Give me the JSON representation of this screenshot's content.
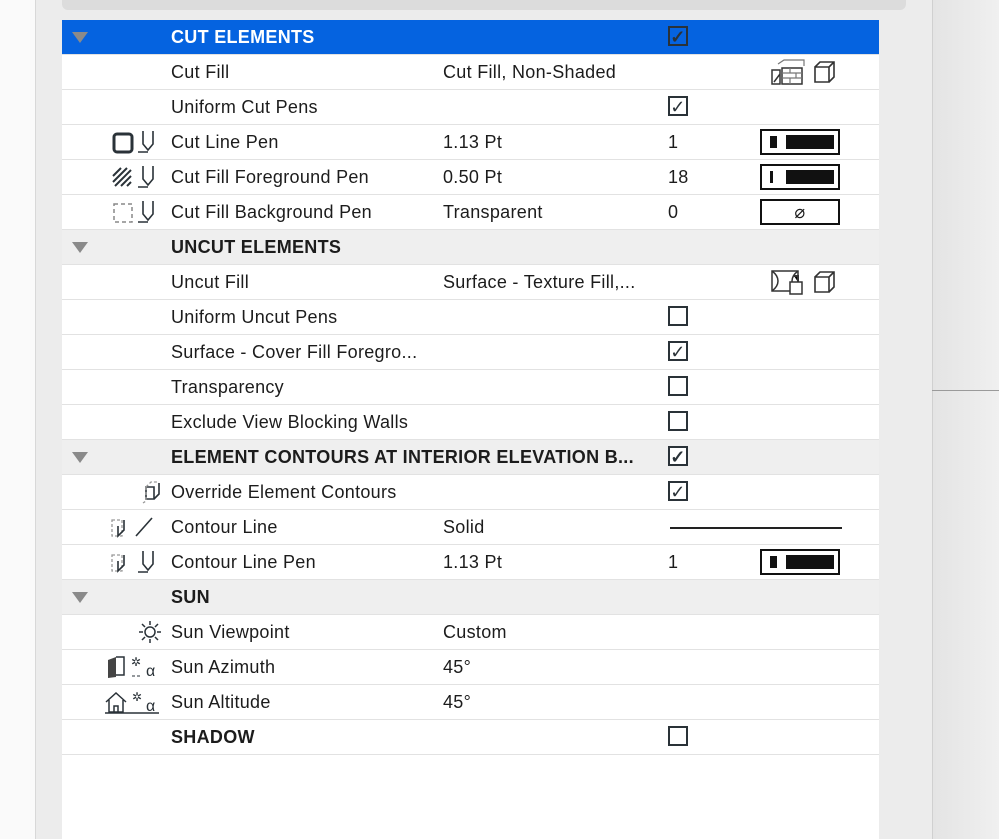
{
  "sections": [
    {
      "title": "CUT ELEMENTS",
      "checked": true,
      "selected": true,
      "rows": [
        {
          "name": "Cut Fill",
          "value": "Cut Fill, Non-Shaded",
          "icon": "fill-type-icons"
        },
        {
          "name": "Uniform Cut Pens",
          "checked": true
        },
        {
          "name": "Cut Line Pen",
          "value": "1.13 Pt",
          "num": "1",
          "icon": "cut-line-pen-icon",
          "pen": "thick"
        },
        {
          "name": "Cut Fill Foreground Pen",
          "value": "0.50 Pt",
          "num": "18",
          "icon": "fill-foreground-pen-icon",
          "pen": "thin"
        },
        {
          "name": "Cut Fill Background Pen",
          "value": "Transparent",
          "num": "0",
          "icon": "fill-background-pen-icon",
          "pen": "none",
          "pen_symbol": "⌀"
        }
      ]
    },
    {
      "title": "UNCUT ELEMENTS",
      "rows": [
        {
          "name": "Uncut Fill",
          "value": "Surface - Texture Fill,..."
        },
        {
          "name": "Uniform Uncut Pens",
          "checked": false
        },
        {
          "name": "Surface - Cover Fill Foregro...",
          "checked": true
        },
        {
          "name": "Transparency",
          "checked": false
        },
        {
          "name": "Exclude View Blocking Walls",
          "checked": false
        }
      ]
    },
    {
      "title": "ELEMENT CONTOURS AT INTERIOR ELEVATION B...",
      "checked": true,
      "rows": [
        {
          "name": "Override Element Contours",
          "checked": true
        },
        {
          "name": "Contour Line",
          "value": "Solid"
        },
        {
          "name": "Contour Line Pen",
          "value": "1.13 Pt",
          "num": "1"
        }
      ]
    },
    {
      "title": "SUN",
      "rows": [
        {
          "name": "Sun Viewpoint",
          "value": "Custom"
        },
        {
          "name": "Sun Azimuth",
          "value": "45°"
        },
        {
          "name": "Sun Altitude",
          "value": "45°"
        }
      ]
    },
    {
      "title": "SHADOW",
      "checked": false
    }
  ],
  "check_mark": "✓",
  "colors": {
    "selection": "#0563e0"
  }
}
